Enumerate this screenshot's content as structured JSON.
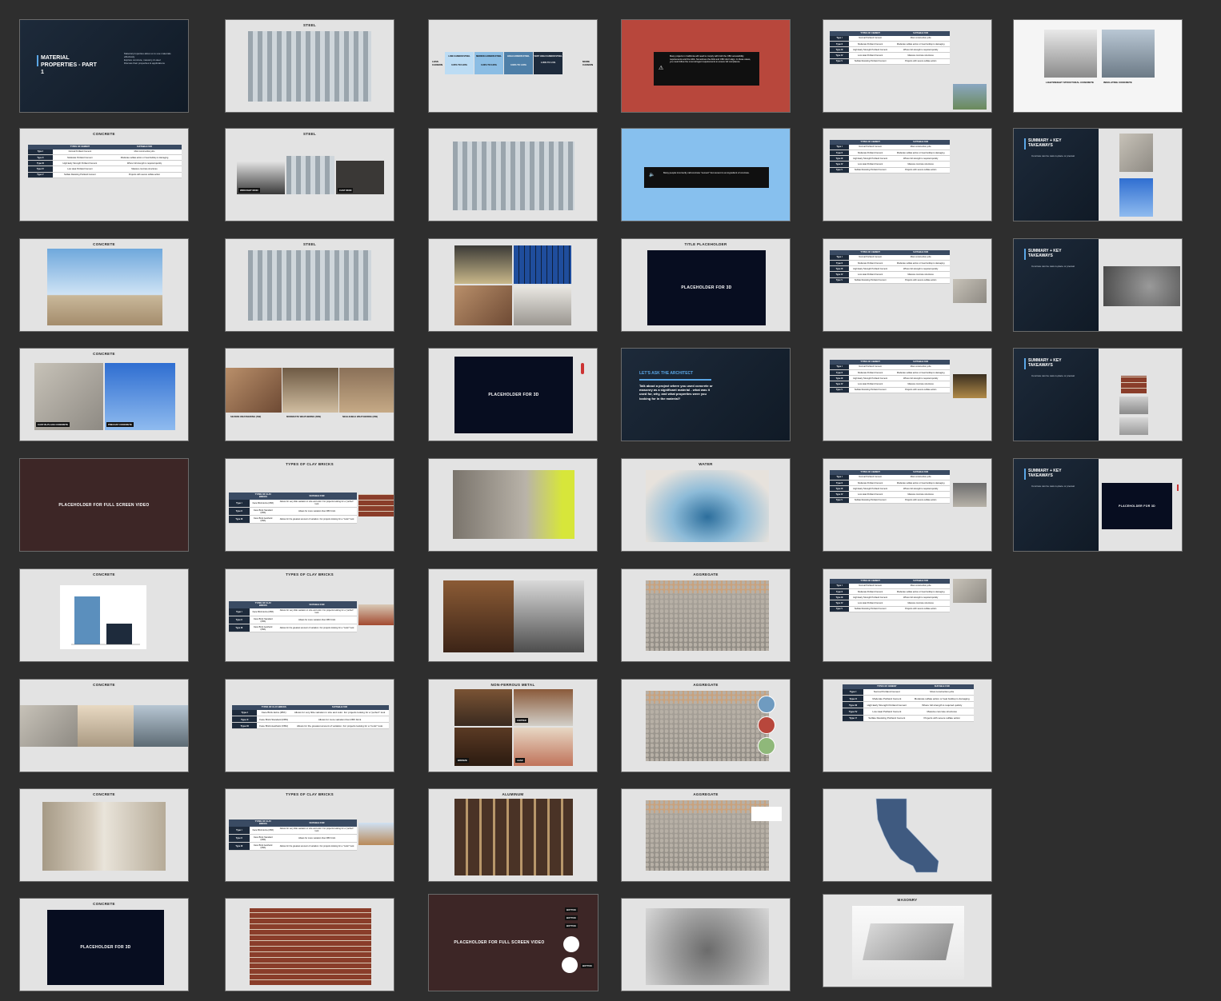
{
  "deck": {
    "title_slide": {
      "title": "MATERIAL PROPERTIES - PART 1",
      "bullets": [
        "Material properties allow us to use materials effectively",
        "Explore concrete, masonry & steel",
        "Discuss their properties & applications"
      ]
    },
    "titles": {
      "steel": "STEEL",
      "concrete": "CONCRETE",
      "title_placeholder": "TITLE PLACEHOLDER",
      "water": "WATER",
      "aggregate": "AGGREGATE",
      "non_ferrous": "NON-FERROUS METAL",
      "aluminum": "ALUMINUM",
      "masonry": "MASONRY",
      "clay_bricks": "TYPES OF CLAY BRICKS",
      "summary": "SUMMARY + KEY TAKEAWAYS",
      "ask_architect": "LET'S ASK THE ARCHITECT"
    },
    "placeholders": {
      "full_video": "PLACEHOLDER FOR FULL SCREEN VIDEO",
      "three_d": "PLACEHOLDER FOR 3D"
    },
    "carbon_scale": {
      "less": "LESS CARBON",
      "more": "MORE CARBON",
      "cols": [
        {
          "name": "LOW-CARBON STEEL",
          "range": "0.05% TO 0.30%"
        },
        {
          "name": "MEDIUM-CARBON STEEL",
          "range": "0.30% TO 0.60%"
        },
        {
          "name": "HIGH-CARBON STEEL",
          "range": "0.60% TO 1.00%"
        },
        {
          "name": "VERY HIGH CARBON STEEL",
          "range": "1.00% TO 1.5%"
        }
      ]
    },
    "alert_red": "Many projects in California will need to comply with both the CBC accessibility requirements and the ADA. Sometimes the ADA and CBC don't align. In those cases, you must follow the most stringent requirements to ensure full compliance.",
    "alert_blue": "Many people incorrectly call concrete \"cement\" but cement is an ingredient of concrete.",
    "ask_question": "Talk about a project where you used concrete or masonry as a significant material - what was it used for, why, and what properties were you looking for in the material?",
    "summary_bullet": "Concrete can be cast-in-place or precast",
    "cement_table": {
      "headers": [
        "TYPES OF CEMENT",
        "SUITABLE FOR"
      ],
      "rows": [
        [
          "Type I",
          "Normal Portland Cement",
          "Most construction jobs"
        ],
        [
          "Type II",
          "Moderate Portland Cement",
          "Moderate sulfate action or heat buildup is damaging"
        ],
        [
          "Type III",
          "High Early Strength Portland Cement",
          "Where full strength is required quickly"
        ],
        [
          "Type IV",
          "Low Heat Portland Cement",
          "Massive concrete structures"
        ],
        [
          "Type V",
          "Sulfate Resisting Portland Cement",
          "Projects with severe sulfate action"
        ]
      ]
    },
    "brick_table": {
      "headers": [
        "TYPES OF CLAY BRICKS",
        "SUITABLE FOR"
      ],
      "rows": [
        [
          "Type I",
          "Face Brick Extra (FBX)",
          "Allows for very little variation in size and color. For projects looking for a \"perfect\" look"
        ],
        [
          "Type II",
          "Face Brick Standard (FBS)",
          "Allows for more variation than FBX brick"
        ],
        [
          "Type III",
          "Face Brick Aesthetic (FBA)",
          "Allows for the greatest amount of variation. For projects looking for a \"rustic\" look"
        ]
      ]
    },
    "weathering": [
      "SEVERE WEATHERING (SW)",
      "MODERATE WEATHERING (MW)",
      "NEGLIGIBLE WEATHERING (NW)"
    ],
    "captions": {
      "cast": "CAST-IN-PLACE CONCRETE",
      "precast": "PRECAST CONCRETE",
      "wrought": "WROUGHT IRON",
      "cast_iron": "CAST IRON",
      "insulating": "INSULATING CONCRETE",
      "lightweight": "LIGHTWEIGHT STRUCTURAL CONCRETE",
      "copper": "COPPER",
      "bronze": "BRONZE",
      "lead": "LEAD"
    },
    "video_buttons": [
      "BUTTON",
      "BUTTON",
      "BUTTON",
      "BUTTON"
    ]
  },
  "colors": {
    "navy": "#1d2a3a",
    "red": "#b8473c",
    "blue": "#87c0ee",
    "maroon": "#3d2626",
    "accent": "#5aa6e6"
  }
}
